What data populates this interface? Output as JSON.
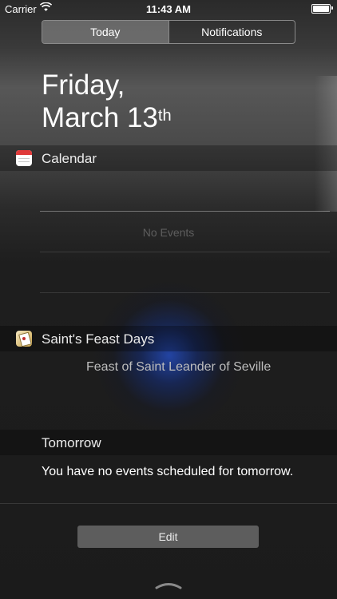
{
  "status_bar": {
    "carrier": "Carrier",
    "time": "11:43 AM"
  },
  "tabs": [
    {
      "label": "Today",
      "selected": true
    },
    {
      "label": "Notifications",
      "selected": false
    }
  ],
  "date": {
    "line1": "Friday,",
    "line2": "March 13",
    "suffix": "th"
  },
  "calendar": {
    "title": "Calendar",
    "empty_message": "No Events"
  },
  "saints": {
    "title": "Saint's Feast Days",
    "feast": "Feast of Saint Leander of Seville"
  },
  "tomorrow": {
    "title": "Tomorrow",
    "message": "You have no events scheduled for tomorrow."
  },
  "edit_label": "Edit",
  "colors": {
    "accent_blue": "#2346aa",
    "calendar_red": "#e03a3a"
  },
  "icons": [
    "wifi-icon",
    "battery-icon",
    "calendar-app-icon",
    "saints-app-icon",
    "grabber-handle-icon"
  ]
}
